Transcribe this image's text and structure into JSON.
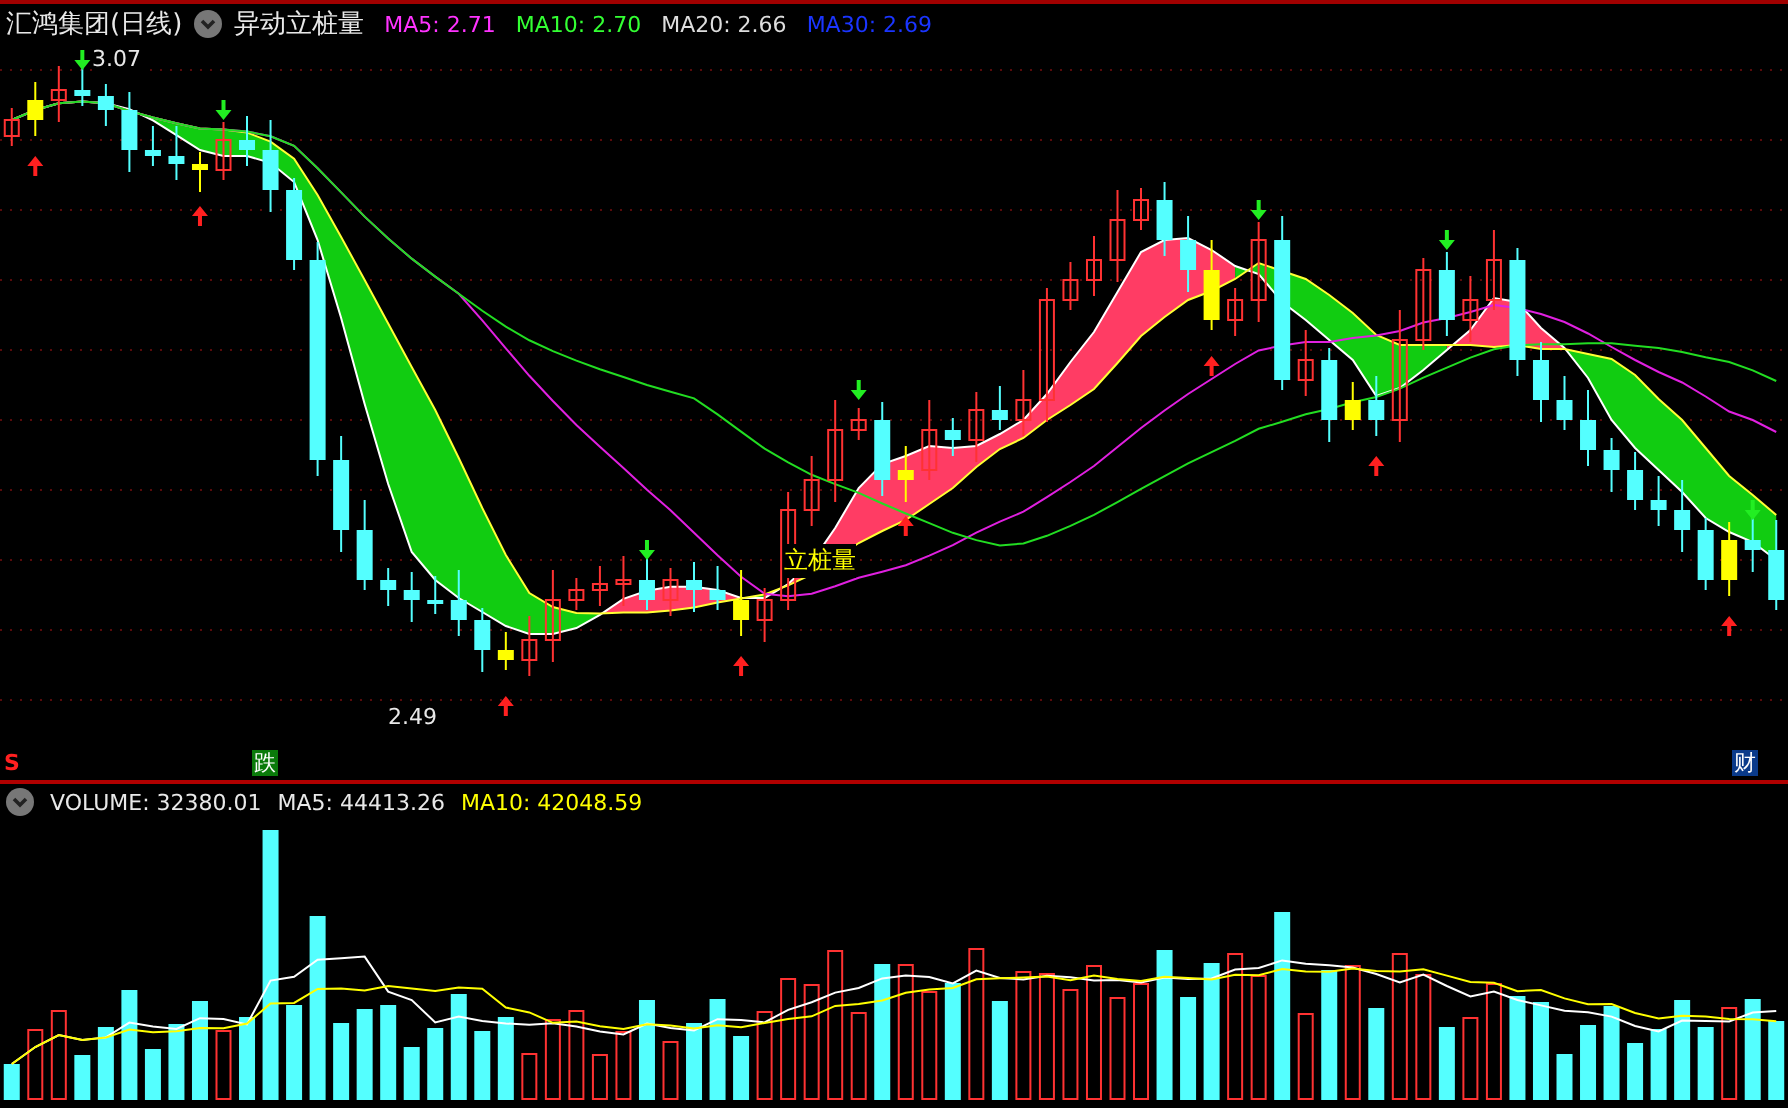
{
  "header": {
    "title": "汇鸿集团(日线)",
    "indicator": "异动立桩量",
    "averages": [
      {
        "text": "MA5: 2.71",
        "color": "#ff33ff"
      },
      {
        "text": "MA10: 2.70",
        "color": "#33ff33"
      },
      {
        "text": "MA20: 2.66",
        "color": "#dddddd"
      },
      {
        "text": "MA30: 2.69",
        "color": "#1a35ff"
      }
    ]
  },
  "price_chart": {
    "high_label": "3.07",
    "low_label": "2.49",
    "signal_label": "立桩量"
  },
  "markers": [
    {
      "kind": "s",
      "text": "S"
    },
    {
      "kind": "fall",
      "text": "跌"
    },
    {
      "kind": "finance",
      "text": "财"
    }
  ],
  "volume": {
    "label": "VOLUME: 32380.01",
    "ma5": "MA5: 44413.26",
    "ma10": "MA10: 42048.59"
  }
}
